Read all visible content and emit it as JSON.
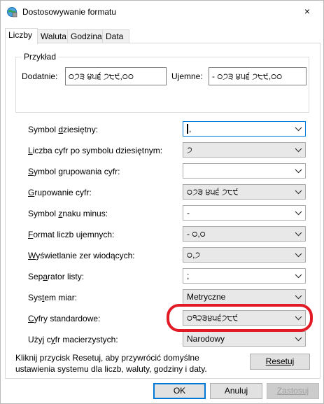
{
  "window": {
    "title": "Dostosowywanie formatu",
    "close_icon": "×"
  },
  "tabs": [
    {
      "label": "Liczby"
    },
    {
      "label": "Waluta"
    },
    {
      "label": "Godzina"
    },
    {
      "label": "Data"
    }
  ],
  "example": {
    "legend": "Przykład",
    "positive_label": "Dodatnie:",
    "positive_value": "੦੭੩ ੪੫੬ ੭੮੯,੦੦",
    "negative_label": "Ujemne:",
    "negative_value": "- ੦੭੩ ੪੫੬ ੭੮੯,੦੦"
  },
  "settings": [
    {
      "label_pre": "Symbol ",
      "label_u": "d",
      "label_post": "ziesiętny:",
      "value": ",",
      "state": "focused"
    },
    {
      "label_pre": "",
      "label_u": "L",
      "label_post": "iczba cyfr po symbolu dziesiętnym:",
      "value": "੭",
      "state": "normal"
    },
    {
      "label_pre": "",
      "label_u": "S",
      "label_post": "ymbol grupowania cyfr:",
      "value": "",
      "state": "white"
    },
    {
      "label_pre": "",
      "label_u": "G",
      "label_post": "rupowanie cyfr:",
      "value": "੦੭੩ ੪੫੬ ੭੮੯",
      "state": "normal"
    },
    {
      "label_pre": "Symbol ",
      "label_u": "z",
      "label_post": "naku minus:",
      "value": "-",
      "state": "white"
    },
    {
      "label_pre": "",
      "label_u": "F",
      "label_post": "ormat liczb ujemnych:",
      "value": "- ੦,੦",
      "state": "normal"
    },
    {
      "label_pre": "",
      "label_u": "W",
      "label_post": "yświetlanie zer wiodących:",
      "value": "੦,੭",
      "state": "normal"
    },
    {
      "label_pre": "Sep",
      "label_u": "a",
      "label_post": "rator listy:",
      "value": ";",
      "state": "white"
    },
    {
      "label_pre": "Sys",
      "label_u": "t",
      "label_post": "em miar:",
      "value": "Metryczne",
      "state": "normal"
    },
    {
      "label_pre": "",
      "label_u": "C",
      "label_post": "yfry standardowe:",
      "value": "੦੧੨੩੪੫੬੭੮੯",
      "state": "normal"
    },
    {
      "label_pre": "Użyj c",
      "label_u": "y",
      "label_post": "fr macierzystych:",
      "value": "Narodowy",
      "state": "normal"
    }
  ],
  "note": "Kliknij przycisk Resetuj, aby przywrócić domyślne ustawienia systemu dla liczb, waluty, godziny i daty.",
  "buttons": {
    "reset": "Resetuj",
    "ok": "OK",
    "cancel": "Anuluj",
    "apply": "Zastosuj"
  },
  "colors": {
    "accent": "#0078d7",
    "highlight": "#e21a25"
  }
}
